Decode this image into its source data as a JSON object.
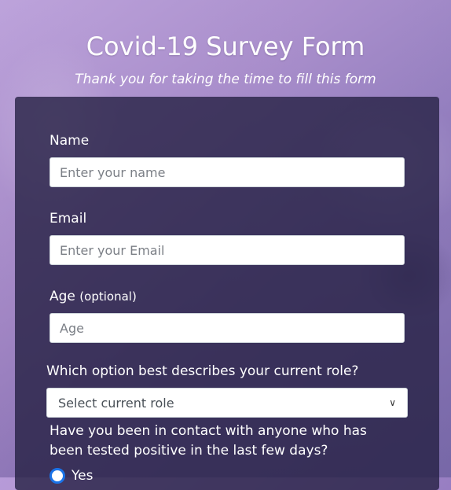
{
  "header": {
    "title": "Covid-19 Survey Form",
    "subtitle": "Thank you for taking the time to fill this form"
  },
  "form": {
    "name": {
      "label": "Name",
      "placeholder": "Enter your name"
    },
    "email": {
      "label": "Email",
      "placeholder": "Enter your Email"
    },
    "age": {
      "label": "Age",
      "optional": "(optional)",
      "placeholder": "Age"
    },
    "role": {
      "question": "Which option best describes your current role?",
      "selected": "Select current role"
    },
    "contact": {
      "question": "Have you been in contact with anyone who has been tested positive in the last few days?",
      "options": [
        "Yes"
      ]
    }
  },
  "colors": {
    "background_accent": "#a487c9",
    "card": "#262044",
    "radio_accent": "#1a73e8"
  }
}
